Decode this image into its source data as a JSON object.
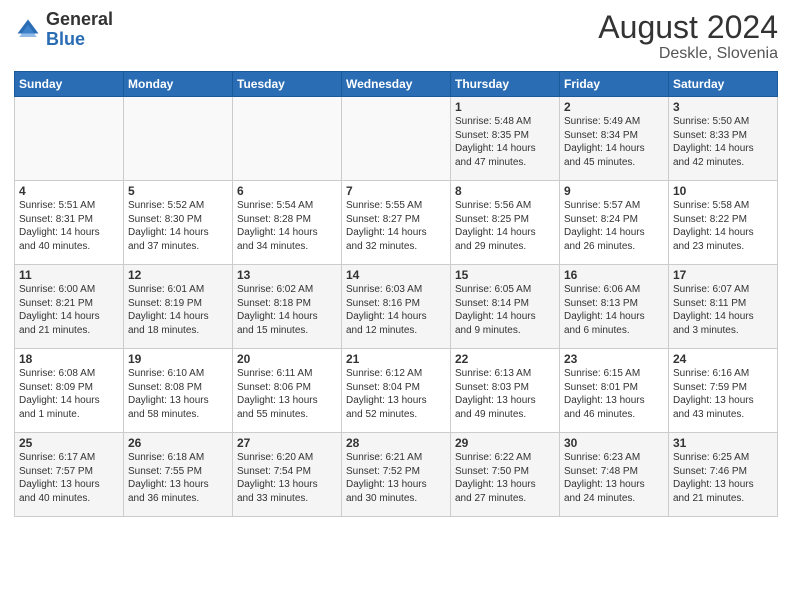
{
  "logo": {
    "general": "General",
    "blue": "Blue"
  },
  "title": {
    "month_year": "August 2024",
    "location": "Deskle, Slovenia"
  },
  "weekdays": [
    "Sunday",
    "Monday",
    "Tuesday",
    "Wednesday",
    "Thursday",
    "Friday",
    "Saturday"
  ],
  "weeks": [
    [
      {
        "day": "",
        "info": ""
      },
      {
        "day": "",
        "info": ""
      },
      {
        "day": "",
        "info": ""
      },
      {
        "day": "",
        "info": ""
      },
      {
        "day": "1",
        "info": "Sunrise: 5:48 AM\nSunset: 8:35 PM\nDaylight: 14 hours\nand 47 minutes."
      },
      {
        "day": "2",
        "info": "Sunrise: 5:49 AM\nSunset: 8:34 PM\nDaylight: 14 hours\nand 45 minutes."
      },
      {
        "day": "3",
        "info": "Sunrise: 5:50 AM\nSunset: 8:33 PM\nDaylight: 14 hours\nand 42 minutes."
      }
    ],
    [
      {
        "day": "4",
        "info": "Sunrise: 5:51 AM\nSunset: 8:31 PM\nDaylight: 14 hours\nand 40 minutes."
      },
      {
        "day": "5",
        "info": "Sunrise: 5:52 AM\nSunset: 8:30 PM\nDaylight: 14 hours\nand 37 minutes."
      },
      {
        "day": "6",
        "info": "Sunrise: 5:54 AM\nSunset: 8:28 PM\nDaylight: 14 hours\nand 34 minutes."
      },
      {
        "day": "7",
        "info": "Sunrise: 5:55 AM\nSunset: 8:27 PM\nDaylight: 14 hours\nand 32 minutes."
      },
      {
        "day": "8",
        "info": "Sunrise: 5:56 AM\nSunset: 8:25 PM\nDaylight: 14 hours\nand 29 minutes."
      },
      {
        "day": "9",
        "info": "Sunrise: 5:57 AM\nSunset: 8:24 PM\nDaylight: 14 hours\nand 26 minutes."
      },
      {
        "day": "10",
        "info": "Sunrise: 5:58 AM\nSunset: 8:22 PM\nDaylight: 14 hours\nand 23 minutes."
      }
    ],
    [
      {
        "day": "11",
        "info": "Sunrise: 6:00 AM\nSunset: 8:21 PM\nDaylight: 14 hours\nand 21 minutes."
      },
      {
        "day": "12",
        "info": "Sunrise: 6:01 AM\nSunset: 8:19 PM\nDaylight: 14 hours\nand 18 minutes."
      },
      {
        "day": "13",
        "info": "Sunrise: 6:02 AM\nSunset: 8:18 PM\nDaylight: 14 hours\nand 15 minutes."
      },
      {
        "day": "14",
        "info": "Sunrise: 6:03 AM\nSunset: 8:16 PM\nDaylight: 14 hours\nand 12 minutes."
      },
      {
        "day": "15",
        "info": "Sunrise: 6:05 AM\nSunset: 8:14 PM\nDaylight: 14 hours\nand 9 minutes."
      },
      {
        "day": "16",
        "info": "Sunrise: 6:06 AM\nSunset: 8:13 PM\nDaylight: 14 hours\nand 6 minutes."
      },
      {
        "day": "17",
        "info": "Sunrise: 6:07 AM\nSunset: 8:11 PM\nDaylight: 14 hours\nand 3 minutes."
      }
    ],
    [
      {
        "day": "18",
        "info": "Sunrise: 6:08 AM\nSunset: 8:09 PM\nDaylight: 14 hours\nand 1 minute."
      },
      {
        "day": "19",
        "info": "Sunrise: 6:10 AM\nSunset: 8:08 PM\nDaylight: 13 hours\nand 58 minutes."
      },
      {
        "day": "20",
        "info": "Sunrise: 6:11 AM\nSunset: 8:06 PM\nDaylight: 13 hours\nand 55 minutes."
      },
      {
        "day": "21",
        "info": "Sunrise: 6:12 AM\nSunset: 8:04 PM\nDaylight: 13 hours\nand 52 minutes."
      },
      {
        "day": "22",
        "info": "Sunrise: 6:13 AM\nSunset: 8:03 PM\nDaylight: 13 hours\nand 49 minutes."
      },
      {
        "day": "23",
        "info": "Sunrise: 6:15 AM\nSunset: 8:01 PM\nDaylight: 13 hours\nand 46 minutes."
      },
      {
        "day": "24",
        "info": "Sunrise: 6:16 AM\nSunset: 7:59 PM\nDaylight: 13 hours\nand 43 minutes."
      }
    ],
    [
      {
        "day": "25",
        "info": "Sunrise: 6:17 AM\nSunset: 7:57 PM\nDaylight: 13 hours\nand 40 minutes."
      },
      {
        "day": "26",
        "info": "Sunrise: 6:18 AM\nSunset: 7:55 PM\nDaylight: 13 hours\nand 36 minutes."
      },
      {
        "day": "27",
        "info": "Sunrise: 6:20 AM\nSunset: 7:54 PM\nDaylight: 13 hours\nand 33 minutes."
      },
      {
        "day": "28",
        "info": "Sunrise: 6:21 AM\nSunset: 7:52 PM\nDaylight: 13 hours\nand 30 minutes."
      },
      {
        "day": "29",
        "info": "Sunrise: 6:22 AM\nSunset: 7:50 PM\nDaylight: 13 hours\nand 27 minutes."
      },
      {
        "day": "30",
        "info": "Sunrise: 6:23 AM\nSunset: 7:48 PM\nDaylight: 13 hours\nand 24 minutes."
      },
      {
        "day": "31",
        "info": "Sunrise: 6:25 AM\nSunset: 7:46 PM\nDaylight: 13 hours\nand 21 minutes."
      }
    ]
  ]
}
